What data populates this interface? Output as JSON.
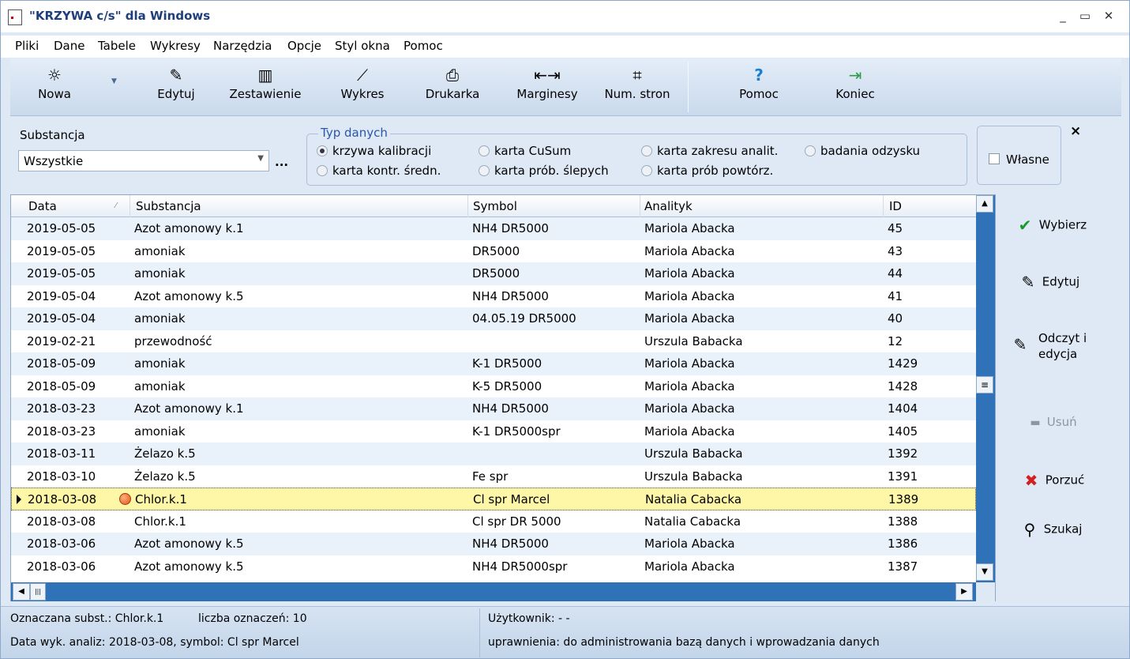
{
  "window": {
    "title": "\"KRZYWA c/s\" dla Windows",
    "minimize": "_",
    "maximize": "▭",
    "close": "✕"
  },
  "menu": [
    "Pliki",
    "Dane",
    "Tabele",
    "Wykresy",
    "Narzędzia",
    "Opcje",
    "Styl okna",
    "Pomoc"
  ],
  "toolbar": {
    "nowa": "Nowa",
    "edytuj": "Edytuj",
    "zestawienie": "Zestawienie",
    "wykres": "Wykres",
    "drukarka": "Drukarka",
    "marginesy": "Marginesy",
    "num_stron": "Num. stron",
    "pomoc": "Pomoc",
    "koniec": "Koniec"
  },
  "filter": {
    "substancja_label": "Substancja",
    "substancja_value": "Wszystkie",
    "dots": "...",
    "group_title": "Typ danych",
    "options": [
      "krzywa kalibracji",
      "karta CuSum",
      "karta zakresu analit.",
      "badania odzysku",
      "karta kontr. średn.",
      "karta prób. ślepych",
      "karta prób powtórz."
    ],
    "selected": "krzywa kalibracji",
    "wlasne": "Własne",
    "close": "×"
  },
  "grid": {
    "columns": [
      "Data",
      "Substancja",
      "Symbol",
      "Analityk",
      "ID"
    ],
    "rows": [
      [
        "2019-05-05",
        "Azot amonowy k.1",
        "NH4 DR5000",
        "Mariola Abacka",
        "45"
      ],
      [
        "2019-05-05",
        "amoniak",
        "DR5000",
        "Mariola Abacka",
        "43"
      ],
      [
        "2019-05-05",
        "amoniak",
        "DR5000",
        "Mariola Abacka",
        "44"
      ],
      [
        "2019-05-04",
        "Azot amonowy k.5",
        "NH4 DR5000",
        "Mariola Abacka",
        "41"
      ],
      [
        "2019-05-04",
        "amoniak",
        "04.05.19 DR5000",
        "Mariola Abacka",
        "40"
      ],
      [
        "2019-02-21",
        "przewodność",
        "",
        "Urszula Babacka",
        "12"
      ],
      [
        "2018-05-09",
        "amoniak",
        "K-1 DR5000",
        "Mariola Abacka",
        "1429"
      ],
      [
        "2018-05-09",
        "amoniak",
        "K-5 DR5000",
        "Mariola Abacka",
        "1428"
      ],
      [
        "2018-03-23",
        "Azot amonowy k.1",
        "NH4 DR5000",
        "Mariola Abacka",
        "1404"
      ],
      [
        "2018-03-23",
        "amoniak",
        "K-1 DR5000spr",
        "Mariola Abacka",
        "1405"
      ],
      [
        "2018-03-11",
        "Żelazo k.5",
        "",
        "Urszula Babacka",
        "1392"
      ],
      [
        "2018-03-10",
        "Żelazo k.5",
        "Fe spr",
        "Urszula Babacka",
        "1391"
      ],
      [
        "2018-03-08",
        "Chlor.k.1",
        "Cl spr Marcel",
        "Natalia Cabacka",
        "1389"
      ],
      [
        "2018-03-08",
        "Chlor.k.1",
        "Cl spr DR 5000",
        "Natalia Cabacka",
        "1388"
      ],
      [
        "2018-03-06",
        "Azot amonowy k.5",
        "NH4 DR5000",
        "Mariola Abacka",
        "1386"
      ],
      [
        "2018-03-06",
        "Azot amonowy k.5",
        "NH4 DR5000spr",
        "Mariola Abacka",
        "1387"
      ]
    ],
    "selected_index": 12
  },
  "side": {
    "wybierz": "Wybierz",
    "edytuj": "Edytuj",
    "odczyt1": "Odczyt i",
    "odczyt2": "edycja",
    "usun": "Usuń",
    "porzuc": "Porzuć",
    "szukaj": "Szukaj"
  },
  "status": {
    "oznaczana": "Oznaczana subst.: Chlor.k.1",
    "liczba": "liczba oznaczeń:  10",
    "data_wyk": "Data wyk. analiz: 2018-03-08, symbol: Cl spr Marcel",
    "uzytkownik": "Użytkownik: - -",
    "uprawnienia": "uprawnienia: do administrowania bazą danych i wprowadzania danych"
  },
  "colors": {
    "accent": "#2f72b8",
    "selection": "#fff7a8",
    "alt_row": "#e9f1fa",
    "title": "#1e3f7a"
  }
}
